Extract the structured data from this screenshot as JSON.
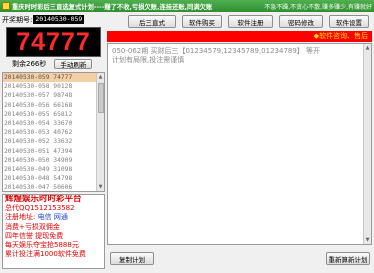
{
  "window": {
    "title": "重庆时时彩后三直选复式计划----赚了不收,亏损欠账,连挂还账,同满欠账",
    "title_right": "不急不躁,不贪心不散,赚多赚少,有赚就好"
  },
  "issue": {
    "label": "开奖期号:",
    "value": "20140530-059"
  },
  "big_number": "74777",
  "remaining": {
    "label": "剩余266秒",
    "refresh_label": "手动刷新"
  },
  "history": [
    "20140530-059 74777",
    "20140530-058 90128",
    "20140530-057 98748",
    "20140530-056 66168",
    "20140530-055 65812",
    "20140530-054 33670",
    "20140530-053 40762",
    "20140530-052 33632",
    "20140530-051 47394",
    "20140530-050 34909",
    "20140530-049 31098",
    "20140530-048 54798",
    "20140530-047 50606",
    "20140530-046 85208",
    "20140530-045 43408"
  ],
  "ads": [
    {
      "text": "辉煌娱乐时时彩平台",
      "style": "big"
    },
    {
      "text": "总代QQ1512153582",
      "style": "red"
    },
    {
      "text": "注册地址: 电信 网通",
      "style": "mixed",
      "prefix": "注册地址: ",
      "link1": "电信",
      "link2": "网通"
    },
    {
      "text": "消费+亏损双佣金",
      "style": "red"
    },
    {
      "text": "四年信誉 提现免费",
      "style": "red"
    },
    {
      "text": "每天娱乐夺宝抢5888元",
      "style": "red"
    },
    {
      "text": "累计投注满1000软件免费",
      "style": "red"
    }
  ],
  "toolbar": {
    "btn1": "后三直式",
    "btn2": "软件购买",
    "btn3": "软件注册",
    "btn4": "密码修改",
    "btn5": "软件设置"
  },
  "notice": "◆软件咨询、售后",
  "plan_text": "050-062期  买财后三【01234579,12345789,01234789】 等开\n计划有局限,投注需谨慎",
  "bottom": {
    "copy_label": "复制计划",
    "refresh_label": "重新算新计划"
  },
  "colors": {
    "title_bar": "#2f8f2f",
    "number": "#ff2b2b",
    "notice_bar": "#ff0000",
    "notice_text": "#ffe000"
  }
}
